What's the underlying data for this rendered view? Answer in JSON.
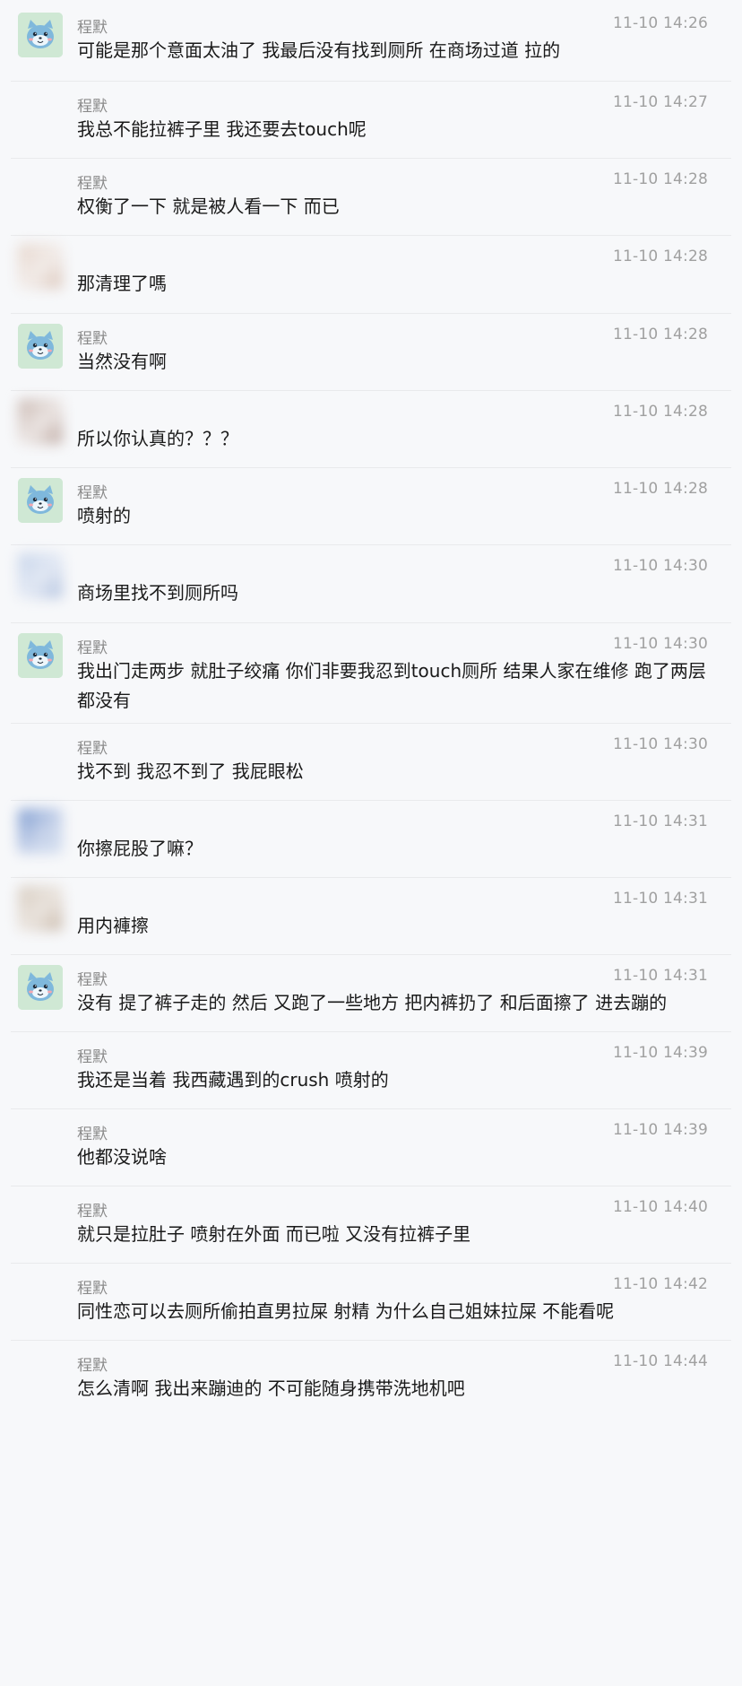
{
  "messages": [
    {
      "sender": "程默",
      "avatar": "cat-icon",
      "time": "11-10 14:26",
      "text": "可能是那个意面太油了 我最后没有找到厕所 在商场过道 拉的"
    },
    {
      "sender": "程默",
      "avatar": "none",
      "time": "11-10 14:27",
      "text": "我总不能拉裤子里 我还要去touch呢"
    },
    {
      "sender": "程默",
      "avatar": "none",
      "time": "11-10 14:28",
      "text": "权衡了一下 就是被人看一下 而已"
    },
    {
      "sender": "",
      "avatar": "blurred-avatar",
      "time": "11-10 14:28",
      "text": "那清理了嗎"
    },
    {
      "sender": "程默",
      "avatar": "cat-icon",
      "time": "11-10 14:28",
      "text": "当然没有啊"
    },
    {
      "sender": "",
      "avatar": "blurred-avatar",
      "time": "11-10 14:28",
      "text": "所以你认真的？？？"
    },
    {
      "sender": "程默",
      "avatar": "cat-icon",
      "time": "11-10 14:28",
      "text": "喷射的"
    },
    {
      "sender": "",
      "avatar": "blurred-avatar",
      "time": "11-10 14:30",
      "text": "商场里找不到厕所吗"
    },
    {
      "sender": "程默",
      "avatar": "cat-icon",
      "time": "11-10 14:30",
      "text": "我出门走两步 就肚子绞痛 你们非要我忍到touch厕所 结果人家在维修 跑了两层 都没有"
    },
    {
      "sender": "程默",
      "avatar": "none",
      "time": "11-10 14:30",
      "text": "找不到 我忍不到了 我屁眼松"
    },
    {
      "sender": "",
      "avatar": "blurred-avatar",
      "time": "11-10 14:31",
      "text": "你擦屁股了嘛？"
    },
    {
      "sender": "",
      "avatar": "blurred-avatar",
      "time": "11-10 14:31",
      "text": "用内褲擦"
    },
    {
      "sender": "程默",
      "avatar": "cat-icon",
      "time": "11-10 14:31",
      "text": "没有 提了裤子走的 然后 又跑了一些地方 把内裤扔了 和后面擦了 进去蹦的"
    },
    {
      "sender": "程默",
      "avatar": "none",
      "time": "11-10 14:39",
      "text": "我还是当着 我西藏遇到的crush 喷射的"
    },
    {
      "sender": "程默",
      "avatar": "none",
      "time": "11-10 14:39",
      "text": "他都没说啥"
    },
    {
      "sender": "程默",
      "avatar": "none",
      "time": "11-10 14:40",
      "text": "就只是拉肚子 喷射在外面 而已啦 又没有拉裤子里"
    },
    {
      "sender": "程默",
      "avatar": "none",
      "time": "11-10 14:42",
      "text": "同性恋可以去厕所偷拍直男拉屎 射精 为什么自己姐妹拉屎 不能看呢"
    },
    {
      "sender": "程默",
      "avatar": "none",
      "time": "11-10 14:44",
      "text": "怎么清啊 我出来蹦迪的 不可能随身携带洗地机吧"
    }
  ],
  "colors": {
    "background": "#f7f8fa",
    "cat_avatar_bg": "#cfe8d4",
    "cat_face": "#7fb8dc",
    "text": "#1a1a1a",
    "meta": "#a0a0a0"
  }
}
